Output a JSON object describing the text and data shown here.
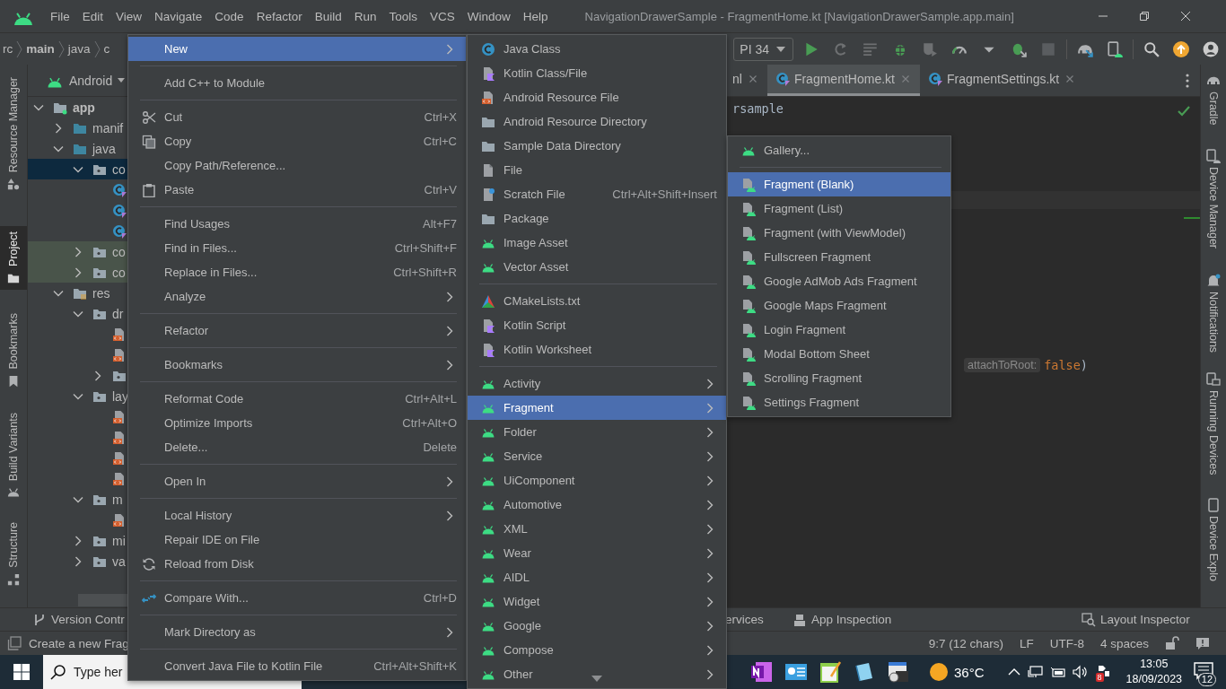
{
  "window": {
    "title": "NavigationDrawerSample - FragmentHome.kt [NavigationDrawerSample.app.main]"
  },
  "menu_bar": [
    "File",
    "Edit",
    "View",
    "Navigate",
    "Code",
    "Refactor",
    "Build",
    "Run",
    "Tools",
    "VCS",
    "Window",
    "Help"
  ],
  "breadcrumb": [
    "rc",
    "main",
    "java",
    "c"
  ],
  "run_config": {
    "device": "PI 34"
  },
  "left_tool_strip": [
    {
      "label": "Resource Manager",
      "selected": false
    },
    {
      "label": "Project",
      "selected": true
    },
    {
      "label": "Bookmarks",
      "selected": false
    },
    {
      "label": "Build Variants",
      "selected": false
    },
    {
      "label": "Structure",
      "selected": false
    }
  ],
  "project_panel": {
    "view": "Android",
    "tree": [
      {
        "label": "app",
        "kind": "module",
        "expanded": true,
        "selected": false,
        "children": [
          {
            "label": "manif",
            "kind": "folder",
            "expanded": false,
            "selected": false
          },
          {
            "label": "java",
            "kind": "folder",
            "expanded": true,
            "selected": false,
            "children": [
              {
                "label": "co",
                "kind": "package",
                "expanded": true,
                "selected": true,
                "children": [
                  {
                    "kind": "kotlin-class",
                    "selected": false
                  },
                  {
                    "kind": "kotlin-class",
                    "selected": false
                  },
                  {
                    "kind": "kotlin-class",
                    "selected": false
                  }
                ]
              },
              {
                "label": "co",
                "kind": "test-package",
                "expanded": false,
                "selected": false
              },
              {
                "label": "co",
                "kind": "test-package",
                "expanded": false,
                "selected": false
              }
            ]
          },
          {
            "label": "res",
            "kind": "res-folder",
            "expanded": true,
            "selected": false,
            "children": [
              {
                "label": "dr",
                "kind": "package",
                "expanded": true,
                "selected": false,
                "children": [
                  {
                    "kind": "xml-file",
                    "selected": false
                  },
                  {
                    "kind": "xml-file",
                    "selected": false
                  },
                  {
                    "kind": "package",
                    "expanded": false,
                    "selected": false
                  }
                ]
              },
              {
                "label": "lay",
                "kind": "package",
                "expanded": true,
                "selected": false,
                "children": [
                  {
                    "kind": "xml-file",
                    "selected": false
                  },
                  {
                    "kind": "xml-file",
                    "selected": false
                  },
                  {
                    "kind": "xml-file",
                    "selected": false
                  },
                  {
                    "kind": "xml-file",
                    "selected": false
                  }
                ]
              },
              {
                "label": "m",
                "kind": "package",
                "expanded": true,
                "selected": false,
                "children": [
                  {
                    "kind": "xml-file",
                    "selected": false
                  }
                ]
              },
              {
                "label": "mi",
                "kind": "package",
                "expanded": false,
                "selected": false
              },
              {
                "label": "va",
                "kind": "package",
                "expanded": false,
                "selected": false
              }
            ]
          }
        ]
      }
    ]
  },
  "editor": {
    "tabs": [
      {
        "label": "nl",
        "selected": false
      },
      {
        "label": "FragmentHome.kt",
        "selected": true
      },
      {
        "label": "FragmentSettings.kt",
        "selected": false
      }
    ],
    "lines": [
      {
        "tokens": [
          {
            "kind": "plain",
            "text": "rsample"
          }
        ]
      },
      {
        "hint": "attachToRoot:",
        "tokens": [
          {
            "kind": "keyword",
            "text": "false"
          },
          {
            "kind": "plain",
            "text": ")"
          }
        ]
      }
    ]
  },
  "right_tool_strip": [
    "Gradle",
    "Device Manager",
    "Notifications",
    "Running Devices",
    "Device Explo"
  ],
  "bottom_tool_bar": [
    "Version Contr",
    "ervices",
    "App Inspection",
    "Layout Inspector"
  ],
  "status_bar": {
    "message": "Create a new Frag",
    "position": "9:7 (12 chars)",
    "line_separator": "LF",
    "encoding": "UTF-8",
    "indent": "4 spaces"
  },
  "taskbar": {
    "search": {
      "placeholder": "Type her"
    },
    "temperature": "36°C",
    "tray_badge": "8",
    "time": "13:05",
    "date": "18/09/2023",
    "notification_count": "12"
  },
  "context_menu": {
    "items": [
      {
        "kind": "item",
        "label": "New",
        "selected": true,
        "submenu": true
      },
      {
        "kind": "separator"
      },
      {
        "kind": "item",
        "label": "Add C++ to Module",
        "selected": false,
        "submenu": false
      },
      {
        "kind": "separator"
      },
      {
        "kind": "item",
        "label": "Cut",
        "shortcut": "Ctrl+X",
        "selected": false,
        "submenu": false
      },
      {
        "kind": "item",
        "label": "Copy",
        "shortcut": "Ctrl+C",
        "selected": false,
        "submenu": false
      },
      {
        "kind": "item",
        "label": "Copy Path/Reference...",
        "selected": false,
        "submenu": false
      },
      {
        "kind": "item",
        "label": "Paste",
        "shortcut": "Ctrl+V",
        "selected": false,
        "submenu": false
      },
      {
        "kind": "separator"
      },
      {
        "kind": "item",
        "label": "Find Usages",
        "shortcut": "Alt+F7",
        "selected": false,
        "submenu": false
      },
      {
        "kind": "item",
        "label": "Find in Files...",
        "shortcut": "Ctrl+Shift+F",
        "selected": false,
        "submenu": false
      },
      {
        "kind": "item",
        "label": "Replace in Files...",
        "shortcut": "Ctrl+Shift+R",
        "selected": false,
        "submenu": false
      },
      {
        "kind": "item",
        "label": "Analyze",
        "selected": false,
        "submenu": true
      },
      {
        "kind": "separator"
      },
      {
        "kind": "item",
        "label": "Refactor",
        "selected": false,
        "submenu": true
      },
      {
        "kind": "separator"
      },
      {
        "kind": "item",
        "label": "Bookmarks",
        "selected": false,
        "submenu": true
      },
      {
        "kind": "separator"
      },
      {
        "kind": "item",
        "label": "Reformat Code",
        "shortcut": "Ctrl+Alt+L",
        "selected": false,
        "submenu": false
      },
      {
        "kind": "item",
        "label": "Optimize Imports",
        "shortcut": "Ctrl+Alt+O",
        "selected": false,
        "submenu": false
      },
      {
        "kind": "item",
        "label": "Delete...",
        "shortcut": "Delete",
        "selected": false,
        "submenu": false
      },
      {
        "kind": "separator"
      },
      {
        "kind": "item",
        "label": "Open In",
        "selected": false,
        "submenu": true
      },
      {
        "kind": "separator"
      },
      {
        "kind": "item",
        "label": "Local History",
        "selected": false,
        "submenu": true
      },
      {
        "kind": "item",
        "label": "Repair IDE on File",
        "selected": false,
        "submenu": false
      },
      {
        "kind": "item",
        "label": "Reload from Disk",
        "selected": false,
        "submenu": false
      },
      {
        "kind": "separator"
      },
      {
        "kind": "item",
        "label": "Compare With...",
        "shortcut": "Ctrl+D",
        "selected": false,
        "submenu": false
      },
      {
        "kind": "separator"
      },
      {
        "kind": "item",
        "label": "Mark Directory as",
        "selected": false,
        "submenu": true
      },
      {
        "kind": "separator"
      },
      {
        "kind": "item",
        "label": "Convert Java File to Kotlin File",
        "shortcut": "Ctrl+Alt+Shift+K",
        "selected": false,
        "submenu": false
      }
    ]
  },
  "new_submenu": {
    "items": [
      {
        "kind": "item",
        "label": "Java Class",
        "selected": false,
        "submenu": false
      },
      {
        "kind": "item",
        "label": "Kotlin Class/File",
        "selected": false,
        "submenu": false
      },
      {
        "kind": "item",
        "label": "Android Resource File",
        "selected": false,
        "submenu": false
      },
      {
        "kind": "item",
        "label": "Android Resource Directory",
        "selected": false,
        "submenu": false
      },
      {
        "kind": "item",
        "label": "Sample Data Directory",
        "selected": false,
        "submenu": false
      },
      {
        "kind": "item",
        "label": "File",
        "selected": false,
        "submenu": false
      },
      {
        "kind": "item",
        "label": "Scratch File",
        "shortcut": "Ctrl+Alt+Shift+Insert",
        "selected": false,
        "submenu": false
      },
      {
        "kind": "item",
        "label": "Package",
        "selected": false,
        "submenu": false
      },
      {
        "kind": "item",
        "label": "Image Asset",
        "selected": false,
        "submenu": false
      },
      {
        "kind": "item",
        "label": "Vector Asset",
        "selected": false,
        "submenu": false
      },
      {
        "kind": "separator"
      },
      {
        "kind": "item",
        "label": "CMakeLists.txt",
        "selected": false,
        "submenu": false
      },
      {
        "kind": "item",
        "label": "Kotlin Script",
        "selected": false,
        "submenu": false
      },
      {
        "kind": "item",
        "label": "Kotlin Worksheet",
        "selected": false,
        "submenu": false
      },
      {
        "kind": "separator"
      },
      {
        "kind": "item",
        "label": "Activity",
        "selected": false,
        "submenu": true
      },
      {
        "kind": "item",
        "label": "Fragment",
        "selected": true,
        "submenu": true
      },
      {
        "kind": "item",
        "label": "Folder",
        "selected": false,
        "submenu": true
      },
      {
        "kind": "item",
        "label": "Service",
        "selected": false,
        "submenu": true
      },
      {
        "kind": "item",
        "label": "UiComponent",
        "selected": false,
        "submenu": true
      },
      {
        "kind": "item",
        "label": "Automotive",
        "selected": false,
        "submenu": true
      },
      {
        "kind": "item",
        "label": "XML",
        "selected": false,
        "submenu": true
      },
      {
        "kind": "item",
        "label": "Wear",
        "selected": false,
        "submenu": true
      },
      {
        "kind": "item",
        "label": "AIDL",
        "selected": false,
        "submenu": true
      },
      {
        "kind": "item",
        "label": "Widget",
        "selected": false,
        "submenu": true
      },
      {
        "kind": "item",
        "label": "Google",
        "selected": false,
        "submenu": true
      },
      {
        "kind": "item",
        "label": "Compose",
        "selected": false,
        "submenu": true
      },
      {
        "kind": "item",
        "label": "Other",
        "selected": false,
        "submenu": true
      }
    ]
  },
  "fragment_submenu": {
    "items": [
      {
        "kind": "item",
        "label": "Gallery...",
        "selected": false,
        "submenu": false
      },
      {
        "kind": "separator"
      },
      {
        "kind": "item",
        "label": "Fragment (Blank)",
        "selected": true,
        "submenu": false
      },
      {
        "kind": "item",
        "label": "Fragment (List)",
        "selected": false,
        "submenu": false
      },
      {
        "kind": "item",
        "label": "Fragment (with ViewModel)",
        "selected": false,
        "submenu": false
      },
      {
        "kind": "item",
        "label": "Fullscreen Fragment",
        "selected": false,
        "submenu": false
      },
      {
        "kind": "item",
        "label": "Google AdMob Ads Fragment",
        "selected": false,
        "submenu": false
      },
      {
        "kind": "item",
        "label": "Google Maps Fragment",
        "selected": false,
        "submenu": false
      },
      {
        "kind": "item",
        "label": "Login Fragment",
        "selected": false,
        "submenu": false
      },
      {
        "kind": "item",
        "label": "Modal Bottom Sheet",
        "selected": false,
        "submenu": false
      },
      {
        "kind": "item",
        "label": "Scrolling Fragment",
        "selected": false,
        "submenu": false
      },
      {
        "kind": "item",
        "label": "Settings Fragment",
        "selected": false,
        "submenu": false
      }
    ]
  }
}
